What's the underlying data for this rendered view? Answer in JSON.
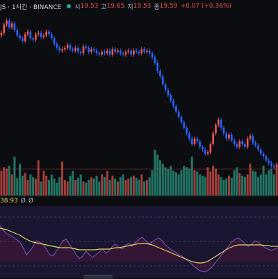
{
  "header": {
    "symbol_fragment": "JS · 1시간 · BINANCE",
    "open_label": "시",
    "open_value": "19.53",
    "high_label": "고",
    "high_value": "19.65",
    "low_label": "저",
    "low_value": "19.53",
    "close_label": "종",
    "close_value": "19.59",
    "change": "+0.07 (+0.36%)"
  },
  "indicator": {
    "value": "38.93",
    "extra1": "Ø",
    "extra2": "Ø"
  },
  "colors": {
    "background": "#0c0d10",
    "up": "#ef5350",
    "down": "#2962ff",
    "vol_up": "#b2433f",
    "vol_down": "#26806f",
    "oscillator": "#7e57c2",
    "signal": "#e6d35a",
    "indicator_bg": "#1a1530"
  },
  "chart_data": {
    "type": "candlestick",
    "closes": [
      19.5,
      19.8,
      19.95,
      19.7,
      19.85,
      19.6,
      19.4,
      19.3,
      19.2,
      19.45,
      19.55,
      19.3,
      19.25,
      19.45,
      19.5,
      19.35,
      19.4,
      19.55,
      19.45,
      19.3,
      19.1,
      18.95,
      18.85,
      18.9,
      18.95,
      19.05,
      18.9,
      18.85,
      18.95,
      18.8,
      18.75,
      19.0,
      18.95,
      18.8,
      18.9,
      18.85,
      18.75,
      18.7,
      18.8,
      18.75,
      18.85,
      18.7,
      18.9,
      18.8,
      18.85,
      18.75,
      18.7,
      18.8,
      18.85,
      18.7,
      18.85,
      18.8,
      18.75,
      18.9,
      18.8,
      18.85,
      18.75,
      18.6,
      18.4,
      18.1,
      17.9,
      17.6,
      17.4,
      17.2,
      17.0,
      16.8,
      16.6,
      16.4,
      16.2,
      16.0,
      15.8,
      15.6,
      15.4,
      15.6,
      15.5,
      15.3,
      15.2,
      15.05,
      15.1,
      15.4,
      15.8,
      16.1,
      16.3,
      16.0,
      15.8,
      15.6,
      15.75,
      15.55,
      15.4,
      15.3,
      15.5,
      15.4,
      15.3,
      15.6,
      15.7,
      15.45,
      15.35,
      15.2,
      15.05,
      14.95,
      14.8,
      14.7,
      14.6,
      14.55,
      14.65
    ],
    "volumes": [
      35,
      40,
      38,
      42,
      30,
      55,
      25,
      45,
      28,
      32,
      22,
      30,
      26,
      24,
      50,
      20,
      35,
      28,
      22,
      30,
      24,
      18,
      26,
      48,
      22,
      20,
      28,
      35,
      22,
      25,
      30,
      20,
      18,
      22,
      26,
      24,
      28,
      20,
      30,
      26,
      35,
      22,
      28,
      24,
      20,
      26,
      30,
      22,
      24,
      26,
      28,
      25,
      22,
      30,
      20,
      22,
      26,
      36,
      65,
      58,
      50,
      45,
      40,
      38,
      42,
      35,
      33,
      30,
      36,
      42,
      40,
      38,
      55,
      36,
      34,
      30,
      28,
      26,
      40,
      34,
      42,
      38,
      30,
      26,
      22,
      24,
      28,
      25,
      36,
      40,
      32,
      28,
      26,
      30,
      45,
      35,
      34,
      26,
      30,
      42,
      30,
      36,
      38,
      30,
      40
    ],
    "oscillator": [
      72,
      65,
      60,
      58,
      55,
      52,
      48,
      40,
      30,
      35,
      42,
      50,
      48,
      45,
      38,
      30,
      28,
      35,
      42,
      50,
      52,
      45,
      38,
      30,
      24,
      28,
      35,
      30,
      26,
      30,
      34,
      38,
      32,
      36,
      42,
      45,
      40,
      38,
      44,
      46,
      42,
      48,
      52,
      55,
      50,
      46,
      48,
      52,
      54,
      50,
      44,
      40,
      36,
      34,
      30,
      28,
      24,
      20,
      16,
      12,
      8,
      6,
      5,
      8,
      12,
      18,
      24,
      30,
      36,
      42,
      48,
      52,
      54,
      50,
      46,
      42,
      45,
      50,
      48,
      44,
      40,
      38,
      36,
      38,
      40
    ],
    "signal": [
      68,
      67,
      66,
      64,
      62,
      60,
      58,
      55,
      52,
      50,
      48,
      47,
      46,
      45,
      44,
      43,
      42,
      41,
      40,
      40,
      40,
      40,
      39,
      38,
      37,
      37,
      37,
      37,
      37,
      37,
      38,
      38,
      38,
      38,
      39,
      40,
      40,
      41,
      42,
      43,
      44,
      45,
      46,
      46,
      46,
      45,
      44,
      42,
      40,
      38,
      36,
      34,
      32,
      30,
      28,
      26,
      24,
      22,
      20,
      19,
      18,
      18,
      19,
      21,
      24,
      27,
      30,
      33,
      36,
      39,
      41,
      43,
      44,
      44,
      44,
      44,
      44,
      44,
      44,
      44,
      43,
      43,
      42,
      42,
      42
    ]
  }
}
